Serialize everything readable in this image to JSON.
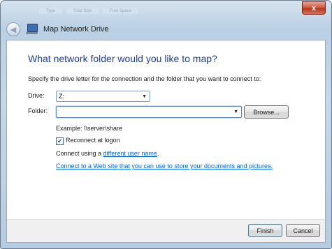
{
  "window": {
    "ghost_tabs": [
      "Type",
      "Total Size",
      "Free Space"
    ],
    "close_symbol": "x",
    "back_symbol": "◀",
    "title": "Map Network Drive"
  },
  "dialog": {
    "heading": "What network folder would you like to map?",
    "instructions": "Specify the drive letter for the connection and the folder that you want to connect to:",
    "drive": {
      "label": "Drive:",
      "value": "Z:",
      "arrow": "▼"
    },
    "folder": {
      "label": "Folder:",
      "value": "",
      "arrow": "▼"
    },
    "browse_label": "Browse...",
    "example": "Example: \\\\server\\share",
    "reconnect": {
      "label": "Reconnect at logon",
      "checked": true,
      "mark": "✔"
    },
    "connect_using_prefix": "Connect using a ",
    "connect_using_link": "different user name",
    "connect_using_suffix": ".",
    "web_link": "Connect to a Web site that you can use to store your documents and pictures."
  },
  "footer": {
    "finish_label": "Finish",
    "cancel_label": "Cancel"
  },
  "icons": {
    "back": "back-arrow-icon",
    "window_icon": "network-drive-icon",
    "close": "close-icon",
    "dropdown": "chevron-down-icon",
    "check": "checkmark-icon"
  }
}
